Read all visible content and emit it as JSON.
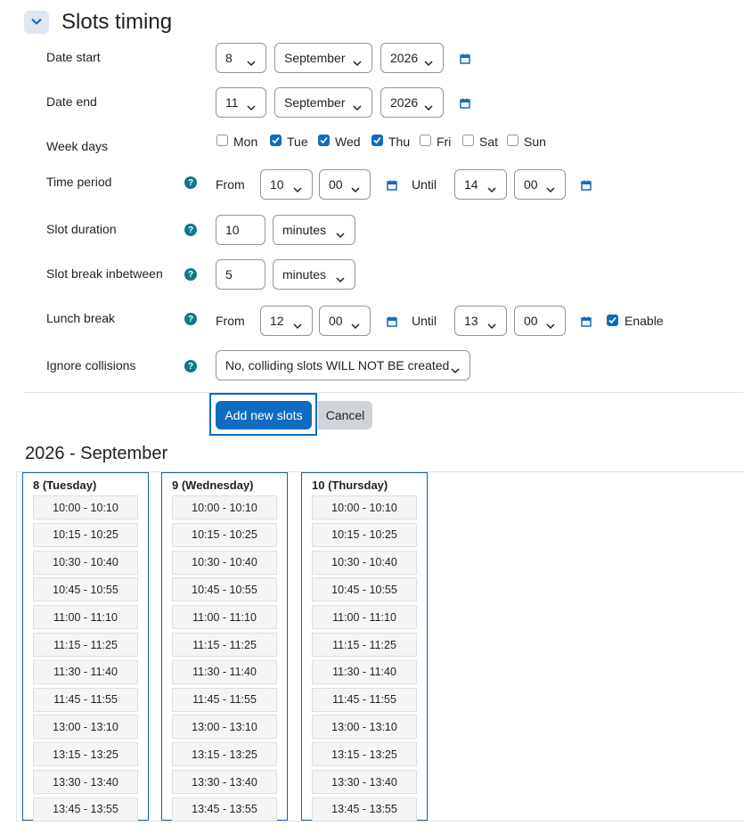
{
  "section": {
    "title": "Slots timing",
    "toggle_icon": "chevron-down-icon"
  },
  "fields": {
    "date_start": {
      "label": "Date start",
      "day": "8",
      "month": "September",
      "year": "2026"
    },
    "date_end": {
      "label": "Date end",
      "day": "11",
      "month": "September",
      "year": "2026"
    },
    "week_days": {
      "label": "Week days",
      "days": [
        {
          "label": "Mon",
          "checked": false
        },
        {
          "label": "Tue",
          "checked": true
        },
        {
          "label": "Wed",
          "checked": true
        },
        {
          "label": "Thu",
          "checked": true
        },
        {
          "label": "Fri",
          "checked": false
        },
        {
          "label": "Sat",
          "checked": false
        },
        {
          "label": "Sun",
          "checked": false
        }
      ]
    },
    "time_period": {
      "label": "Time period",
      "from_label": "From",
      "from_hour": "10",
      "from_minute": "00",
      "until_label": "Until",
      "until_hour": "14",
      "until_minute": "00"
    },
    "slot_duration": {
      "label": "Slot duration",
      "value": "10",
      "unit": "minutes"
    },
    "slot_break": {
      "label": "Slot break inbetween",
      "value": "5",
      "unit": "minutes"
    },
    "lunch_break": {
      "label": "Lunch break",
      "from_label": "From",
      "from_hour": "12",
      "from_minute": "00",
      "until_label": "Until",
      "until_hour": "13",
      "until_minute": "00",
      "enable_label": "Enable",
      "enabled": true
    },
    "ignore_collisions": {
      "label": "Ignore collisions",
      "value": "No, colliding slots WILL NOT BE created"
    }
  },
  "actions": {
    "add_label": "Add new slots",
    "cancel_label": "Cancel"
  },
  "calendar": {
    "title": "2026 - September",
    "days": [
      {
        "title": "8 (Tuesday)",
        "slots": [
          "10:00 - 10:10",
          "10:15 - 10:25",
          "10:30 - 10:40",
          "10:45 - 10:55",
          "11:00 - 11:10",
          "11:15 - 11:25",
          "11:30 - 11:40",
          "11:45 - 11:55",
          "13:00 - 13:10",
          "13:15 - 13:25",
          "13:30 - 13:40",
          "13:45 - 13:55"
        ]
      },
      {
        "title": "9 (Wednesday)",
        "slots": [
          "10:00 - 10:10",
          "10:15 - 10:25",
          "10:30 - 10:40",
          "10:45 - 10:55",
          "11:00 - 11:10",
          "11:15 - 11:25",
          "11:30 - 11:40",
          "11:45 - 11:55",
          "13:00 - 13:10",
          "13:15 - 13:25",
          "13:30 - 13:40",
          "13:45 - 13:55"
        ]
      },
      {
        "title": "10 (Thursday)",
        "slots": [
          "10:00 - 10:10",
          "10:15 - 10:25",
          "10:30 - 10:40",
          "10:45 - 10:55",
          "11:00 - 11:10",
          "11:15 - 11:25",
          "11:30 - 11:40",
          "11:45 - 11:55",
          "13:00 - 13:10",
          "13:15 - 13:25",
          "13:30 - 13:40",
          "13:45 - 13:55"
        ]
      }
    ]
  },
  "colors": {
    "accent": "#0f6cbf",
    "help": "#117789",
    "border": "#8f959e"
  }
}
